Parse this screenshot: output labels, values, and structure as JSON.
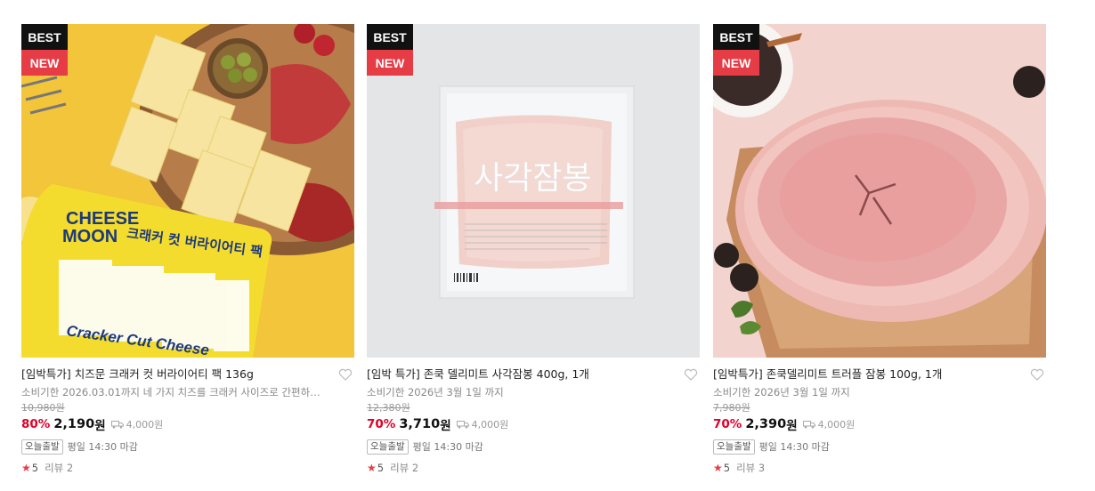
{
  "products": [
    {
      "badges": {
        "best": "BEST",
        "new": "NEW"
      },
      "title": "[임박특가] 치즈문 크래커 컷 버라이어티 팩 136g",
      "description": "소비기한 2026.03.01까지 네 가지 치즈를 크래커 사이즈로 간편하게 ...",
      "original_price": "10,980원",
      "discount": "80%",
      "price": "2,190",
      "currency": "원",
      "shipping_fee": "4,000원",
      "delivery_tag": "오늘출발",
      "cutoff": "평일 14:30 마감",
      "rating": "5",
      "review": "리뷰 2"
    },
    {
      "badges": {
        "best": "BEST",
        "new": "NEW"
      },
      "title": "[임박 특가] 존쿡 델리미트 사각잠봉 400g, 1개",
      "description": "소비기한 2026년 3월 1일 까지",
      "original_price": "12,380원",
      "discount": "70%",
      "price": "3,710",
      "currency": "원",
      "shipping_fee": "4,000원",
      "delivery_tag": "오늘출발",
      "cutoff": "평일 14:30 마감",
      "rating": "5",
      "review": "리뷰 2",
      "package_text": "사각잠봉"
    },
    {
      "badges": {
        "best": "BEST",
        "new": "NEW"
      },
      "title": "[임박특가] 존쿡델리미트 트러플 잠봉 100g, 1개",
      "description": "소비기한 2026년 3월 1일 까지",
      "original_price": "7,980원",
      "discount": "70%",
      "price": "2,390",
      "currency": "원",
      "shipping_fee": "4,000원",
      "delivery_tag": "오늘출발",
      "cutoff": "평일 14:30 마감",
      "rating": "5",
      "review": "리뷰 3"
    }
  ],
  "icons": {
    "star": "★",
    "heart": "heart-outline-icon",
    "truck": "truck-icon"
  },
  "colors": {
    "best_bg": "#111111",
    "new_bg": "#e63c46",
    "discount": "#e0002a",
    "star": "#e63c46"
  }
}
